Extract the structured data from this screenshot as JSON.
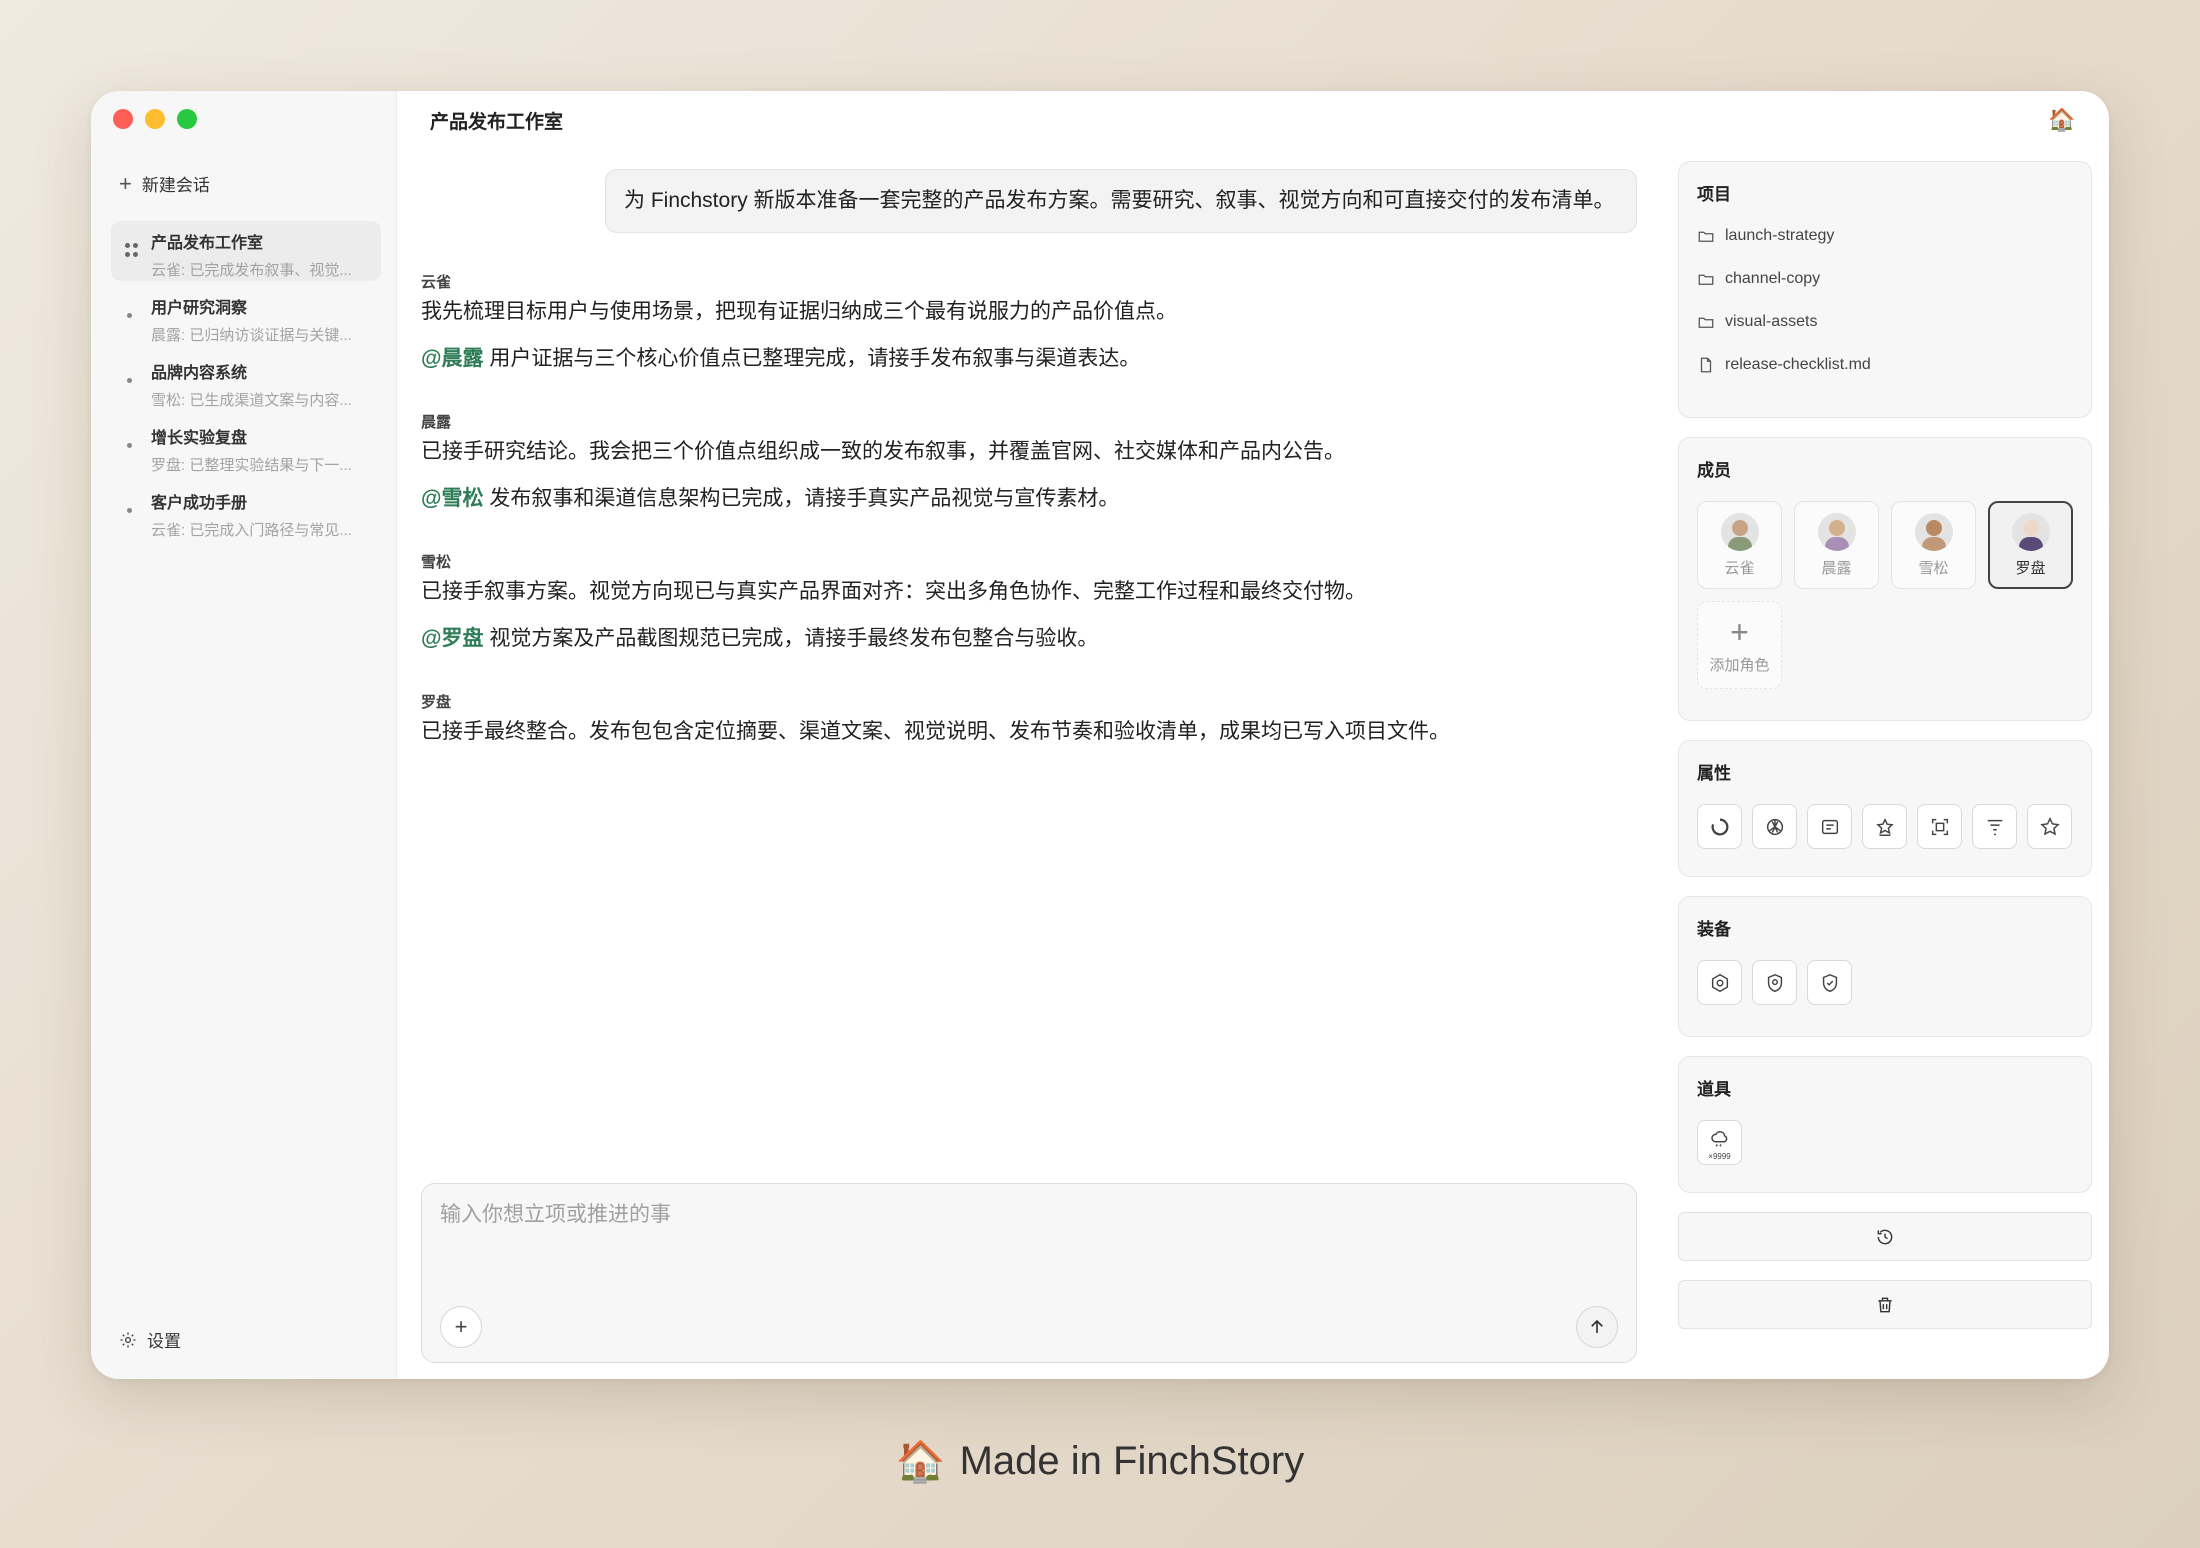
{
  "window": {
    "title": "产品发布工作室",
    "home_icon": "house-icon"
  },
  "sidebar": {
    "new_chat_label": "新建会话",
    "settings_label": "设置",
    "conversations": [
      {
        "title": "产品发布工作室",
        "subtitle": "云雀: 已完成发布叙事、视觉...",
        "active": true
      },
      {
        "title": "用户研究洞察",
        "subtitle": "晨露: 已归纳访谈证据与关键..."
      },
      {
        "title": "品牌内容系统",
        "subtitle": "雪松: 已生成渠道文案与内容..."
      },
      {
        "title": "增长实验复盘",
        "subtitle": "罗盘: 已整理实验结果与下一..."
      },
      {
        "title": "客户成功手册",
        "subtitle": "云雀: 已完成入门路径与常见..."
      }
    ]
  },
  "chat": {
    "user_message": "为 Finchstory 新版本准备一套完整的产品发布方案。需要研究、叙事、视觉方向和可直接交付的发布清单。",
    "messages": [
      {
        "speaker": "云雀",
        "line1": "我先梳理目标用户与使用场景，把现有证据归纳成三个最有说服力的产品价值点。",
        "mention": "@晨露",
        "line2": "用户证据与三个核心价值点已整理完成，请接手发布叙事与渠道表达。"
      },
      {
        "speaker": "晨露",
        "line1": "已接手研究结论。我会把三个价值点组织成一致的发布叙事，并覆盖官网、社交媒体和产品内公告。",
        "mention": "@雪松",
        "line2": "发布叙事和渠道信息架构已完成，请接手真实产品视觉与宣传素材。"
      },
      {
        "speaker": "雪松",
        "line1": "已接手叙事方案。视觉方向现已与真实产品界面对齐：突出多角色协作、完整工作过程和最终交付物。",
        "mention": "@罗盘",
        "line2": "视觉方案及产品截图规范已完成，请接手最终发布包整合与验收。"
      },
      {
        "speaker": "罗盘",
        "line1": "已接手最终整合。发布包包含定位摘要、渠道文案、视觉说明、发布节奏和验收清单，成果均已写入项目文件。"
      }
    ]
  },
  "composer": {
    "placeholder": "输入你想立项或推进的事"
  },
  "right_panel": {
    "project": {
      "title": "项目",
      "files": [
        {
          "name": "launch-strategy",
          "icon": "folder-icon"
        },
        {
          "name": "channel-copy",
          "icon": "folder-icon"
        },
        {
          "name": "visual-assets",
          "icon": "folder-icon"
        },
        {
          "name": "release-checklist.md",
          "icon": "file-icon"
        }
      ]
    },
    "members": {
      "title": "成员",
      "list": [
        {
          "name": "云雀",
          "color": "#8a9b7a",
          "selected": false
        },
        {
          "name": "晨露",
          "color": "#a98fb8",
          "selected": false
        },
        {
          "name": "雪松",
          "color": "#c09a78",
          "selected": false
        },
        {
          "name": "罗盘",
          "color": "#5a4a78",
          "selected": true
        }
      ],
      "add_label": "添加角色"
    },
    "attributes": {
      "title": "属性",
      "icons": [
        "progress-icon",
        "openai-icon",
        "card-icon",
        "star-outline-icon",
        "scan-icon",
        "filter-icon",
        "star-icon"
      ]
    },
    "equipment": {
      "title": "装备",
      "icons": [
        "hexagon-badge-icon",
        "shield-badge-icon",
        "shield-check-icon"
      ]
    },
    "items": {
      "title": "道具",
      "list": [
        {
          "icon": "rain-cloud-icon",
          "count": "×9999"
        }
      ]
    },
    "actions": [
      "history-icon",
      "trash-icon"
    ]
  },
  "footer": {
    "text": "Made in FinchStory",
    "icon": "house-icon"
  }
}
